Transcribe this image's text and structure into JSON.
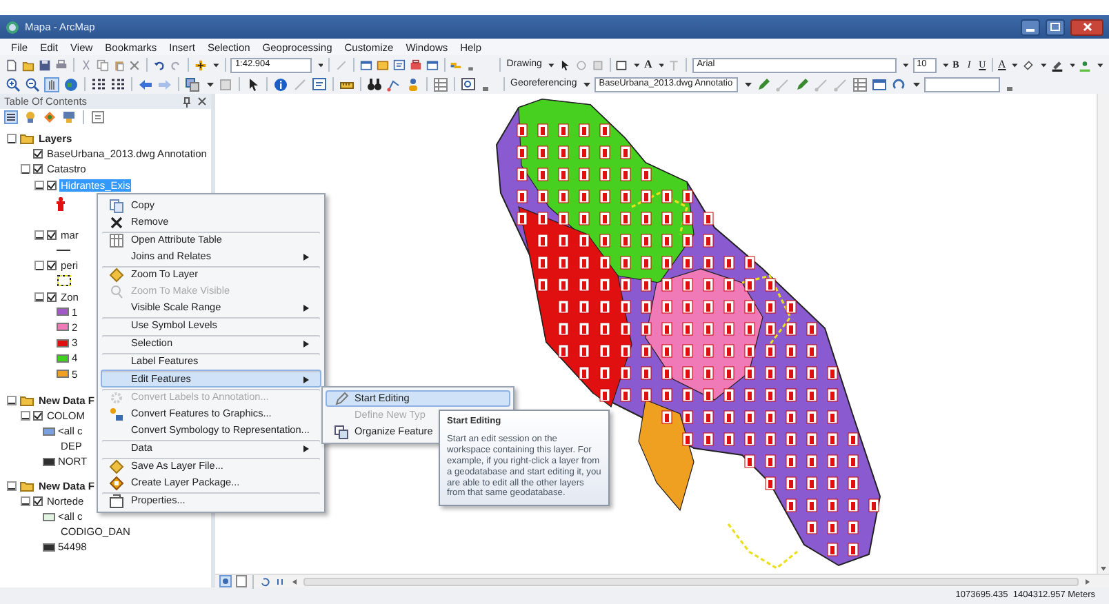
{
  "window": {
    "title": "Mapa - ArcMap"
  },
  "menu_bar": [
    "File",
    "Edit",
    "View",
    "Bookmarks",
    "Insert",
    "Selection",
    "Geoprocessing",
    "Customize",
    "Windows",
    "Help"
  ],
  "toolbars": {
    "scale": "1:42.904",
    "drawing": "Drawing",
    "font": "Arial",
    "font_size": "10",
    "bold": "B",
    "italic": "I",
    "underline": "U",
    "font_color": "A",
    "text_tool": "A",
    "georeferencing": "Georeferencing",
    "layer_combo": "BaseUrbana_2013.dwg Annotatio"
  },
  "table_of_contents": {
    "title": "Table Of Contents",
    "tree": [
      {
        "label": "Layers",
        "kind": "group",
        "expanded": true,
        "children": [
          {
            "label": "BaseUrbana_2013.dwg Annotation",
            "kind": "layer",
            "checked": true,
            "selected": false
          },
          {
            "label": "Catastro",
            "kind": "layer",
            "checked": true,
            "selected": false,
            "expanded": true,
            "children": [
              {
                "label": "Hidrantes_Exis",
                "kind": "layer",
                "checked": true,
                "selected": true,
                "expanded": true,
                "children": [
                  {
                    "kind": "point"
                  }
                ]
              },
              {
                "label": "mar",
                "kind": "layer",
                "checked": true,
                "selected": false,
                "expanded": true,
                "children": [
                  {
                    "kind": "line"
                  }
                ]
              },
              {
                "label": "peri",
                "kind": "layer",
                "checked": true,
                "selected": false,
                "expanded": true,
                "children": [
                  {
                    "kind": "outline"
                  }
                ]
              },
              {
                "label": "Zon",
                "kind": "layer",
                "checked": true,
                "selected": false,
                "expanded": true,
                "children": [
                  {
                    "kind": "fill",
                    "label": "1",
                    "color": "#a259c8"
                  },
                  {
                    "kind": "fill",
                    "label": "2",
                    "color": "#f07ab8"
                  },
                  {
                    "kind": "fill",
                    "label": "3",
                    "color": "#e01010"
                  },
                  {
                    "kind": "fill",
                    "label": "4",
                    "color": "#40d020"
                  },
                  {
                    "kind": "fill",
                    "label": "5",
                    "color": "#f0a020"
                  }
                ]
              }
            ]
          }
        ]
      },
      {
        "label": "New Data F",
        "kind": "group",
        "expanded": true,
        "children": [
          {
            "label": "COLOM",
            "kind": "layer",
            "checked": true,
            "selected": false,
            "expanded": true,
            "children": [
              {
                "kind": "fill",
                "label": "<all c",
                "color": "#7aa0e0"
              },
              {
                "kind": "text",
                "label": "DEP"
              },
              {
                "kind": "fill",
                "label": "NORT",
                "color": "#303030"
              }
            ]
          }
        ]
      },
      {
        "label": "New Data F",
        "kind": "group",
        "expanded": true,
        "children": [
          {
            "label": "Nortede",
            "kind": "layer",
            "checked": true,
            "selected": false,
            "expanded": true,
            "children": [
              {
                "kind": "fill",
                "label": "<all c",
                "color": "#e0f4e0"
              },
              {
                "kind": "text",
                "label": "CODIGO_DAN"
              },
              {
                "kind": "fill",
                "label": "54498",
                "color": "#303030"
              }
            ]
          }
        ]
      }
    ]
  },
  "context_menu": [
    {
      "label": "Copy",
      "disabled": false,
      "submenu": false,
      "selected": false,
      "divider_above": false
    },
    {
      "label": "Remove",
      "disabled": false,
      "submenu": false,
      "selected": false,
      "divider_above": false
    },
    {
      "label": "Open Attribute Table",
      "disabled": false,
      "submenu": false,
      "selected": false,
      "divider_above": true
    },
    {
      "label": "Joins and Relates",
      "disabled": false,
      "submenu": true,
      "selected": false,
      "divider_above": false
    },
    {
      "label": "Zoom To Layer",
      "disabled": false,
      "submenu": false,
      "selected": false,
      "divider_above": true
    },
    {
      "label": "Zoom To Make Visible",
      "disabled": true,
      "submenu": false,
      "selected": false,
      "divider_above": false
    },
    {
      "label": "Visible Scale Range",
      "disabled": false,
      "submenu": true,
      "selected": false,
      "divider_above": false
    },
    {
      "label": "Use Symbol Levels",
      "disabled": false,
      "submenu": false,
      "selected": false,
      "divider_above": true
    },
    {
      "label": "Selection",
      "disabled": false,
      "submenu": true,
      "selected": false,
      "divider_above": true
    },
    {
      "label": "Label Features",
      "disabled": false,
      "submenu": false,
      "selected": false,
      "divider_above": true
    },
    {
      "label": "Edit Features",
      "disabled": false,
      "submenu": true,
      "selected": true,
      "divider_above": true
    },
    {
      "label": "Convert Labels to Annotation...",
      "disabled": true,
      "submenu": false,
      "selected": false,
      "divider_above": true
    },
    {
      "label": "Convert Features to Graphics...",
      "disabled": false,
      "submenu": false,
      "selected": false,
      "divider_above": false
    },
    {
      "label": "Convert Symbology to Representation...",
      "disabled": false,
      "submenu": false,
      "selected": false,
      "divider_above": false
    },
    {
      "label": "Data",
      "disabled": false,
      "submenu": true,
      "selected": false,
      "divider_above": true
    },
    {
      "label": "Save As Layer File...",
      "disabled": false,
      "submenu": false,
      "selected": false,
      "divider_above": true
    },
    {
      "label": "Create Layer Package...",
      "disabled": false,
      "submenu": false,
      "selected": false,
      "divider_above": false
    },
    {
      "label": "Properties...",
      "disabled": false,
      "submenu": false,
      "selected": false,
      "divider_above": true
    }
  ],
  "submenu": [
    {
      "label": "Start Editing",
      "disabled": false,
      "selected": true
    },
    {
      "label": "Define New Typ",
      "disabled": true,
      "selected": false
    },
    {
      "label": "Organize Feature",
      "disabled": false,
      "selected": false
    }
  ],
  "tooltip": {
    "title": "Start Editing",
    "body": "Start an edit session on the workspace containing this layer. For example, if you right-click a layer from a geodatabase and start editing it, you are able to edit all the other layers from that same geodatabase."
  },
  "status_bar": {
    "coordinates": "1073695.435  1404312.957 Meters"
  }
}
